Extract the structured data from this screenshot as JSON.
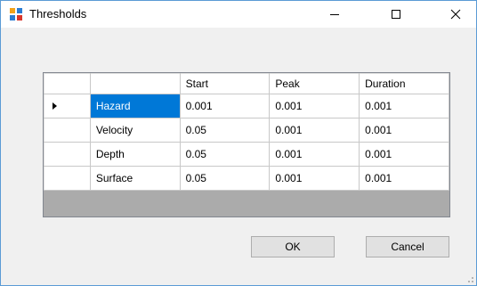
{
  "window": {
    "title": "Thresholds"
  },
  "grid": {
    "columns": [
      "",
      "Start",
      "Peak",
      "Duration"
    ],
    "rows": [
      {
        "name": "Hazard",
        "values": [
          "0.001",
          "0.001",
          "0.001"
        ],
        "current": true,
        "selected": true
      },
      {
        "name": "Velocity",
        "values": [
          "0.05",
          "0.001",
          "0.001"
        ]
      },
      {
        "name": "Depth",
        "values": [
          "0.05",
          "0.001",
          "0.001"
        ]
      },
      {
        "name": "Surface",
        "values": [
          "0.05",
          "0.001",
          "0.001"
        ]
      }
    ]
  },
  "buttons": {
    "ok": "OK",
    "cancel": "Cancel"
  },
  "colors": {
    "selection": "#0078d7",
    "grid_background": "#ababab",
    "window_border": "#5b9bd5"
  }
}
